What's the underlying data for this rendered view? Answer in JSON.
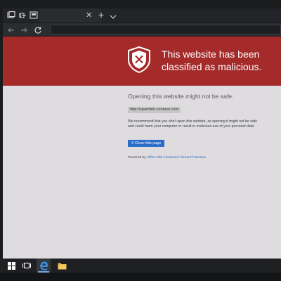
{
  "browser": {
    "tab_close_glyph": "✕",
    "new_tab_glyph": "+",
    "address_value": ""
  },
  "page": {
    "headline": "This website has been classified as malicious.",
    "subheading": "Opening this website might not be safe.",
    "url": "http://spamlink.contoso.com",
    "advice": "We recommend that you don't open this website, as opening it might not be safe and could harm your computer or result in malicious use of your personal data.",
    "close_button": "X Close this page",
    "powered_prefix": "Powered by ",
    "powered_link": "Office 365 Advanced Threat Protection"
  },
  "colors": {
    "banner": "#a52a2a",
    "page_bg": "#dedcdf",
    "button": "#2a6cc8"
  },
  "taskbar": {
    "icons": [
      "windows-start-icon",
      "task-view-icon",
      "edge-icon",
      "file-explorer-icon"
    ]
  }
}
